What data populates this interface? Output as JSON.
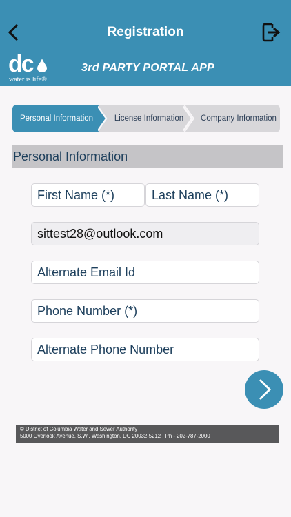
{
  "header": {
    "title": "Registration",
    "back_icon": "chevron-left-icon",
    "logout_icon": "logout-icon"
  },
  "banner": {
    "logo_text": "dc",
    "logo_tagline": "water is life®",
    "app_title": "3rd PARTY PORTAL APP"
  },
  "stepper": {
    "steps": [
      {
        "label": "Personal Information",
        "active": true
      },
      {
        "label": "License Information",
        "active": false
      },
      {
        "label": "Company Information",
        "active": false
      }
    ]
  },
  "section": {
    "title": "Personal Information"
  },
  "form": {
    "first_name_placeholder": "First Name (*)",
    "last_name_placeholder": "Last Name (*)",
    "email_value": "sittest28@outlook.com",
    "alt_email_placeholder": "Alternate Email Id",
    "phone_placeholder": "Phone Number (*)",
    "alt_phone_placeholder": "Alternate Phone Number",
    "next_icon": "chevron-right-icon"
  },
  "footer": {
    "line1": "© District of Columbia Water and Sewer Authority",
    "line2": "5000 Overlook Avenue, S.W., Washington, DC 20032-5212 , Ph - 202-787-2000"
  },
  "colors": {
    "primary": "#3b8fb4",
    "step_inactive": "#d8d7da",
    "section_bg": "#c5c4c7",
    "footer_bg": "#58585a"
  }
}
